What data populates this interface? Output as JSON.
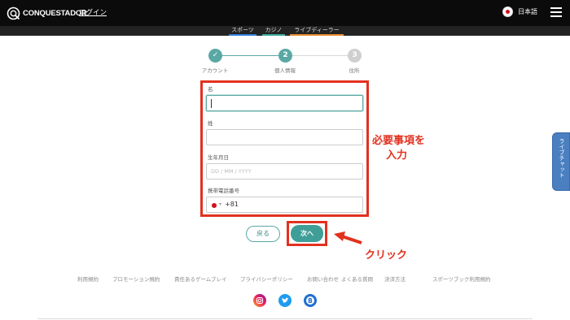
{
  "header": {
    "logo_text": "CONQUESTADOR",
    "login_label": "ログイン",
    "language_label": "日本語",
    "menu_icon": "hamburger-icon"
  },
  "subnav": {
    "items": [
      {
        "label": "スポーツ",
        "color": "#2e7fd8"
      },
      {
        "label": "カジノ",
        "color": "#3aa89a"
      },
      {
        "label": "ライブディーラー",
        "color": "#e58a2e"
      }
    ]
  },
  "steps": {
    "items": [
      {
        "label": "アカウント",
        "marker": "✓",
        "state": "done"
      },
      {
        "label": "個人情報",
        "marker": "2",
        "state": "current"
      },
      {
        "label": "住所",
        "marker": "3",
        "state": "upcoming"
      }
    ],
    "colors": {
      "active": "#5aa8a4",
      "inactive": "#cfcfcf"
    }
  },
  "form": {
    "first_name": {
      "label": "名",
      "value": ""
    },
    "last_name": {
      "label": "姓",
      "value": ""
    },
    "birthdate": {
      "label": "生年月日",
      "placeholder": "DD / MM / YYYY"
    },
    "phone": {
      "label": "携帯電話番号",
      "country_code": "+81"
    }
  },
  "annotations": {
    "required_line1": "必要事項を",
    "required_line2": "入力",
    "click": "クリック",
    "color": "#e2311f"
  },
  "buttons": {
    "back_label": "戻る",
    "next_label": "次へ"
  },
  "footer": {
    "links": [
      "利用規約",
      "プロモーション規約",
      "責任あるゲームプレイ",
      "プライバシーポリシー",
      "お問い合わせ",
      "よくある質問",
      "決済方法",
      "スポーツブック利用規約"
    ],
    "social_icons": [
      "instagram-icon",
      "twitter-icon",
      "blog-icon"
    ]
  },
  "live_chat": {
    "label": "ライブチャット",
    "color": "#4a7fc0"
  }
}
